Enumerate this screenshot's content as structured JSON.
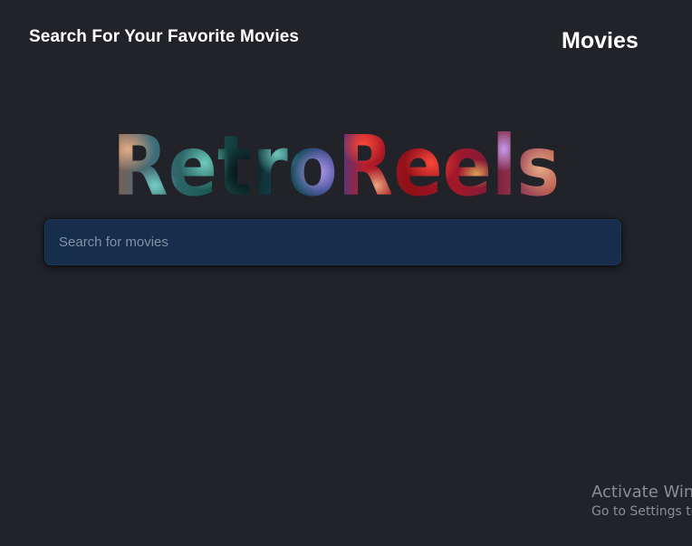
{
  "header": {
    "tagline": "Search For Your Favorite Movies",
    "nav_movies": "Movies"
  },
  "logo": {
    "text": "RetroReels"
  },
  "search": {
    "placeholder": "Search for movies",
    "value": ""
  },
  "watermark": {
    "line1": "Activate Win",
    "line2": "Go to Settings to"
  },
  "colors": {
    "background": "#212329",
    "search_bg": "#162d4b",
    "text": "#ffffff"
  }
}
